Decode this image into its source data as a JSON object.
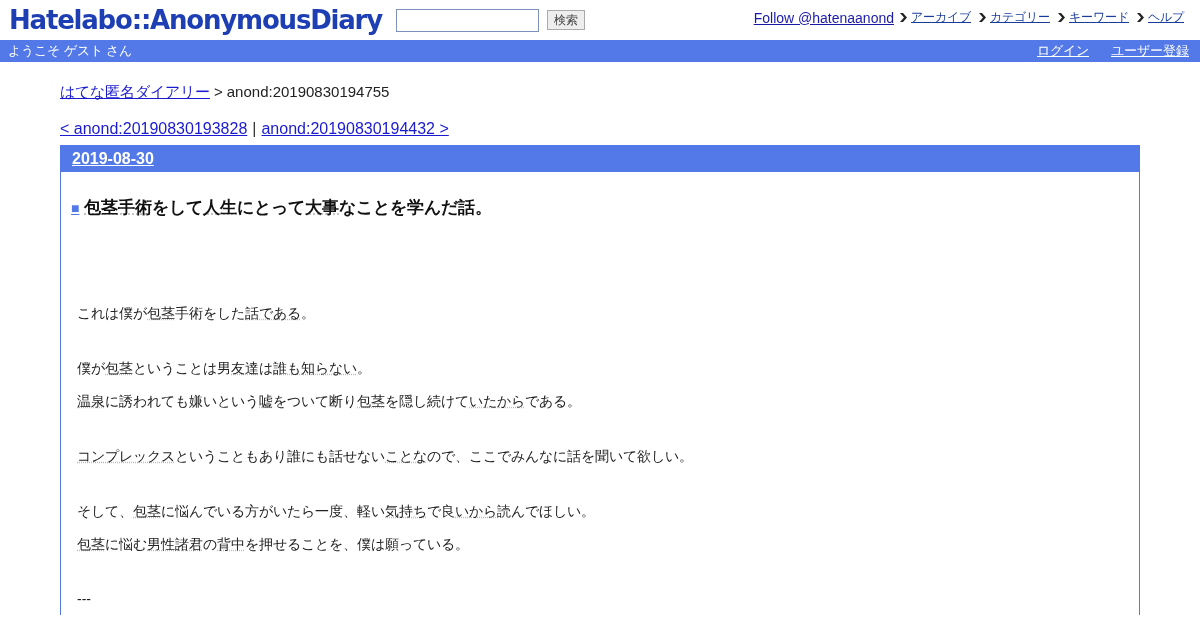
{
  "header": {
    "logo": "Hatelabo::AnonymousDiary",
    "search": {
      "button": "検索"
    },
    "follow": "Follow @hatenaanond",
    "links": [
      {
        "label": "アーカイブ"
      },
      {
        "label": "カテゴリー"
      },
      {
        "label": "キーワード"
      },
      {
        "label": "ヘルプ"
      }
    ]
  },
  "user_bar": {
    "greeting": "ようこそ ゲスト さん",
    "links": [
      "ログイン",
      "ユーザー登録"
    ]
  },
  "breadcrumb": {
    "home": "はてな匿名ダイアリー",
    "separator": ">",
    "current": "anond:20190830194755"
  },
  "entry_nav": {
    "previous": "< anond:20190830193828",
    "separator": "|",
    "next": "anond:20190830194432 >"
  },
  "entry": {
    "date": "2019-08-30",
    "mark": "■",
    "title": [
      {
        "text": "包茎手術",
        "keyword": true
      },
      {
        "text": "をして",
        "keyword": false
      },
      {
        "text": "人生",
        "keyword": true
      },
      {
        "text": "にとって",
        "keyword": false
      },
      {
        "text": "大事",
        "keyword": true
      },
      {
        "text": "なことを学んだ話。",
        "keyword": false
      }
    ],
    "sections": [
      [
        [
          {
            "text": "これは僕が",
            "keyword": false
          },
          {
            "text": "包茎",
            "keyword": true
          },
          {
            "text": "手術をした",
            "keyword": false
          },
          {
            "text": "話である",
            "keyword": true
          },
          {
            "text": "。",
            "keyword": false
          }
        ]
      ],
      [
        [
          {
            "text": "僕が",
            "keyword": false
          },
          {
            "text": "包茎",
            "keyword": true
          },
          {
            "text": "ということは男",
            "keyword": false
          },
          {
            "text": "友達",
            "keyword": true
          },
          {
            "text": "は",
            "keyword": false
          },
          {
            "text": "誰も知らない",
            "keyword": true
          },
          {
            "text": "。",
            "keyword": false
          }
        ],
        [
          {
            "text": "温泉",
            "keyword": true
          },
          {
            "text": "に誘われても嫌いという",
            "keyword": false
          },
          {
            "text": "嘘",
            "keyword": true
          },
          {
            "text": "をついて断り",
            "keyword": false
          },
          {
            "text": "包茎",
            "keyword": true
          },
          {
            "text": "を隠し続けて",
            "keyword": false
          },
          {
            "text": "いたから",
            "keyword": true
          },
          {
            "text": "である。",
            "keyword": false
          }
        ]
      ],
      [
        [
          {
            "text": "コンプレックス",
            "keyword": true
          },
          {
            "text": "ということもあり誰にも話せない",
            "keyword": false
          },
          {
            "text": "ことな",
            "keyword": true
          },
          {
            "text": "ので、ここでみんなに話を聞いて欲しい。",
            "keyword": false
          }
        ]
      ],
      [
        [
          {
            "text": "そして、",
            "keyword": false
          },
          {
            "text": "包茎",
            "keyword": true
          },
          {
            "text": "に悩んでいる方がいたら一度、軽い",
            "keyword": false
          },
          {
            "text": "気持ち",
            "keyword": true
          },
          {
            "text": "で良",
            "keyword": false
          },
          {
            "text": "いから",
            "keyword": true
          },
          {
            "text": "読んでほしい。",
            "keyword": false
          }
        ],
        [
          {
            "text": "包茎",
            "keyword": true
          },
          {
            "text": "に悩む",
            "keyword": false
          },
          {
            "text": "男性諸君",
            "keyword": true
          },
          {
            "text": "の",
            "keyword": false
          },
          {
            "text": "背中",
            "keyword": true
          },
          {
            "text": "を押せることを、僕は願っている。",
            "keyword": false
          }
        ]
      ],
      [
        [
          {
            "text": "---",
            "keyword": false
          }
        ]
      ]
    ]
  }
}
